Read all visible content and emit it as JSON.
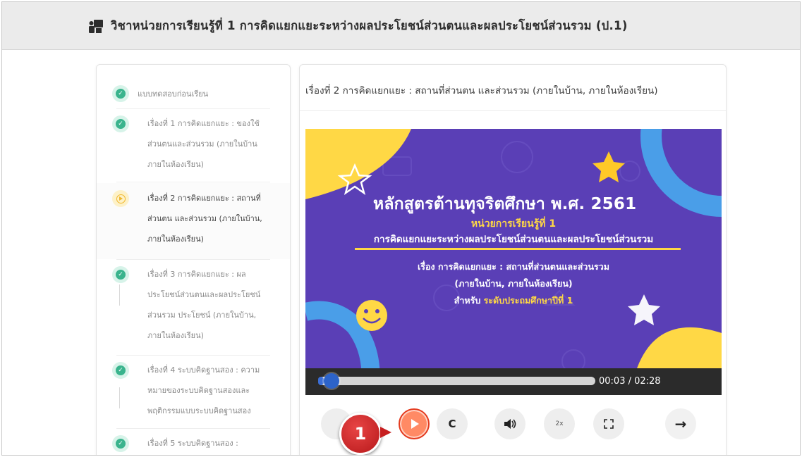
{
  "header": {
    "title": "วิชาหน่วยการเรียนรู้ที่ 1 การคิดแยกแยะระหว่างผลประโยชน์ส่วนตนและผลประโยชน์ส่วนรวม (ป.1)",
    "icon": "teacher-board-icon"
  },
  "sidebar": {
    "items": [
      {
        "label": "แบบทดสอบก่อนเรียน",
        "status": "done"
      },
      {
        "label_lines": [
          "เรื่องที่ 1 การคิดแยกแยะ : ของใช้",
          "ส่วนตนและส่วนรวม (ภายในบ้าน",
          "ภายในห้องเรียน)"
        ],
        "status": "done"
      },
      {
        "label_lines": [
          "เรื่องที่ 2 การคิดแยกแยะ : สถานที่",
          "ส่วนตน และส่วนรวม (ภายในบ้าน,",
          "ภายในห้องเรียน)"
        ],
        "status": "current"
      },
      {
        "label_lines": [
          "เรื่องที่ 3 การคิดแยกแยะ : ผล",
          "ประโยชน์ส่วนตนและผลประโยชน์",
          "ส่วนรวม ประโยชน์ (ภายในบ้าน,",
          "ภายในห้องเรียน)"
        ],
        "status": "done"
      },
      {
        "label_lines": [
          "เรื่องที่ 4 ระบบคิดฐานสอง : ความ",
          "หมายของระบบคิดฐานสองและ",
          "พฤติกรรมแบบระบบคิดฐานสอง"
        ],
        "status": "done"
      },
      {
        "label_lines": [
          "เรื่องที่ 5 ระบบคิดฐานสอง :"
        ],
        "status": "done"
      }
    ]
  },
  "main": {
    "title": "เรื่องที่ 2 การคิดแยกแยะ : สถานที่ส่วนตน และส่วนรวม (ภายในบ้าน, ภายในห้องเรียน)"
  },
  "video": {
    "slide_title": "หลักสูตรต้านทุจริตศึกษา พ.ศ. 2561",
    "slide_unit": "หน่วยการเรียนรู้ที่ 1",
    "slide_subtitle": "การคิดแยกแยะระหว่างผลประโยชน์ส่วนตนและผลประโยชน์ส่วนรวม",
    "topic_line1": "เรื่อง การคิดแยกแยะ : สถานที่ส่วนตนและส่วนรวม",
    "topic_line2": "(ภายในบ้าน, ภายในห้องเรียน)",
    "level_prefix": "สำหรับ",
    "level_value": "ระดับประถมศึกษาปีที่ 1",
    "time": "00:03 / 02:28",
    "progress_fraction": 0.02
  },
  "controls": {
    "speed_label": "2x",
    "reload_glyph": "C",
    "next_glyph": "→",
    "fullscreen_glyph": "⛶",
    "volume_glyph": "◀))"
  },
  "callout": {
    "number": "1"
  },
  "colors": {
    "accent_play": "#ff8a65",
    "done_green": "#3ab48d",
    "current_yellow": "#f0b72c",
    "slide_purple": "#5a3fb6",
    "slide_yellow": "#ffd845",
    "callout_red": "#c71f20"
  }
}
